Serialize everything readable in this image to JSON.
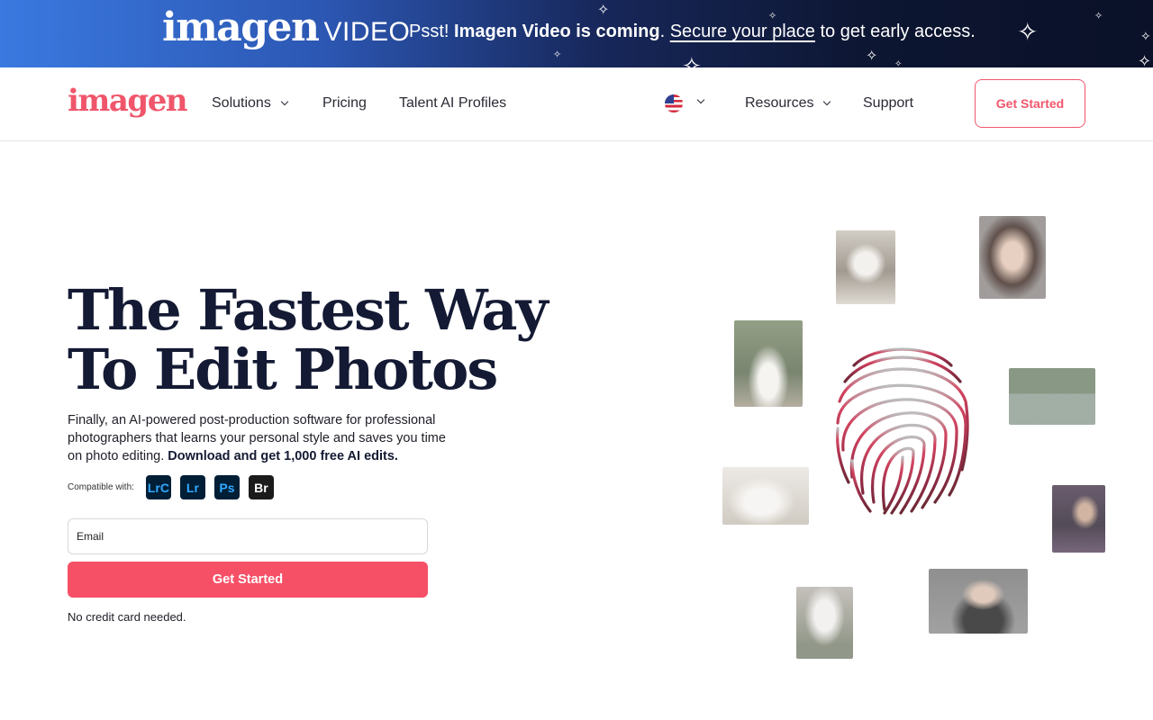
{
  "banner": {
    "logo_brand": "imagen",
    "logo_tag": "VIDEO",
    "text_prefix": "Psst!",
    "text_bold": "Imagen Video is coming",
    "text_dot": ".",
    "link": "Secure your place",
    "text_suffix": "to get early access."
  },
  "nav": {
    "logo": "imagen",
    "items": [
      {
        "label": "Solutions"
      },
      {
        "label": "Pricing"
      },
      {
        "label": "Talent AI Profiles"
      },
      {
        "label": "Resources"
      },
      {
        "label": "Support"
      }
    ],
    "cta": "Get Started"
  },
  "hero": {
    "title_line1": "The Fastest Way",
    "title_line2": "To Edit Photos",
    "desc": "Finally, an AI-powered post-production software for professional photographers that learns your personal style and saves you time on photo editing.",
    "desc_bold": "Download and get 1,000 free AI edits.",
    "compat_label": "Compatible with:",
    "apps": [
      {
        "abbr": "LrC",
        "color": "#31a8ff",
        "bg": "#001e36"
      },
      {
        "abbr": "Lr",
        "color": "#31a8ff",
        "bg": "#001e36"
      },
      {
        "abbr": "Ps",
        "color": "#31a8ff",
        "bg": "#001e36"
      },
      {
        "abbr": "Br",
        "color": "#ffffff",
        "bg": "#1b1b1b"
      }
    ],
    "email_placeholder": "Email",
    "cta": "Get Started",
    "note": "No credit card needed."
  },
  "colors": {
    "accent": "#f65067",
    "heading": "#141a33"
  }
}
